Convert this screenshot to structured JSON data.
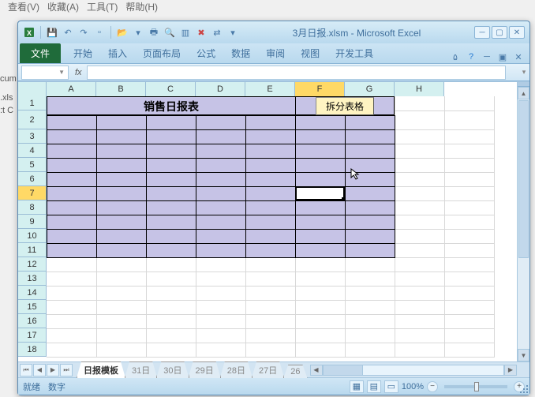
{
  "behind_menus": [
    "查看(V)",
    "收藏(A)",
    "工具(T)",
    "帮助(H)"
  ],
  "behind_left": [
    "cum",
    ".xls",
    ":t C"
  ],
  "title": "3月日报.xlsm - Microsoft Excel",
  "ribbon": {
    "file": "文件",
    "tabs": [
      "开始",
      "插入",
      "页面布局",
      "公式",
      "数据",
      "审阅",
      "视图",
      "开发工具"
    ]
  },
  "formula_bar": {
    "fx": "fx",
    "name_box": ""
  },
  "columns": [
    "A",
    "B",
    "C",
    "D",
    "E",
    "F",
    "G",
    "H"
  ],
  "selected_col": "F",
  "rows": [
    1,
    2,
    3,
    4,
    5,
    6,
    7,
    8,
    9,
    10,
    11,
    12,
    13,
    14,
    15,
    16,
    17,
    18
  ],
  "selected_row": 7,
  "sheet_title": "销售日报表",
  "split_button": "拆分表格",
  "sheet_tabs": {
    "active": "日报模板",
    "others": [
      "31日",
      "30日",
      "29日",
      "28日",
      "27日",
      "26"
    ]
  },
  "statusbar": {
    "ready": "就绪",
    "digit": "数字",
    "zoom": "100%"
  },
  "chart_data": null
}
